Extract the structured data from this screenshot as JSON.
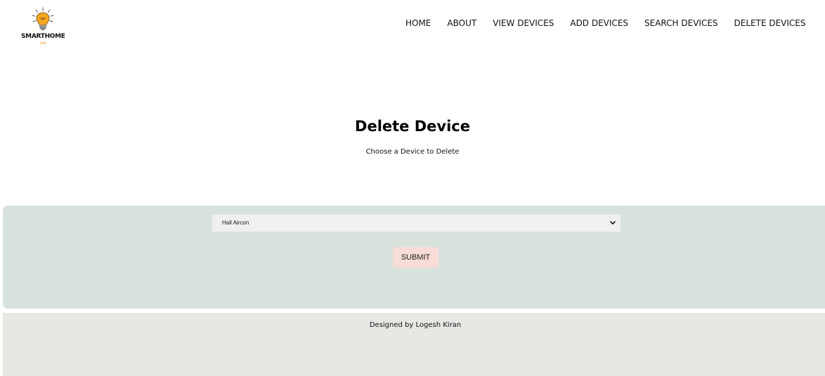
{
  "brand": {
    "name": "SMARTHOME",
    "tagline": "HUB",
    "icon": "lightbulb-icon",
    "accent_color": "#f5a623"
  },
  "nav": {
    "items": [
      {
        "label": "HOME"
      },
      {
        "label": "ABOUT"
      },
      {
        "label": "VIEW DEVICES"
      },
      {
        "label": "ADD DEVICES"
      },
      {
        "label": "SEARCH DEVICES"
      },
      {
        "label": "DELETE DEVICES"
      }
    ]
  },
  "main": {
    "title": "Delete Device",
    "subtitle": "Choose a Device to Delete",
    "panel_color": "#d7e2dd"
  },
  "form": {
    "device_select": {
      "selected": "Hall Aircon",
      "icon": "chevron-down-icon"
    },
    "submit_label": "SUBMIT",
    "submit_color": "#f7dcd7"
  },
  "footer": {
    "text": "Designed by Logesh Kiran",
    "background": "#e7e8e3"
  }
}
